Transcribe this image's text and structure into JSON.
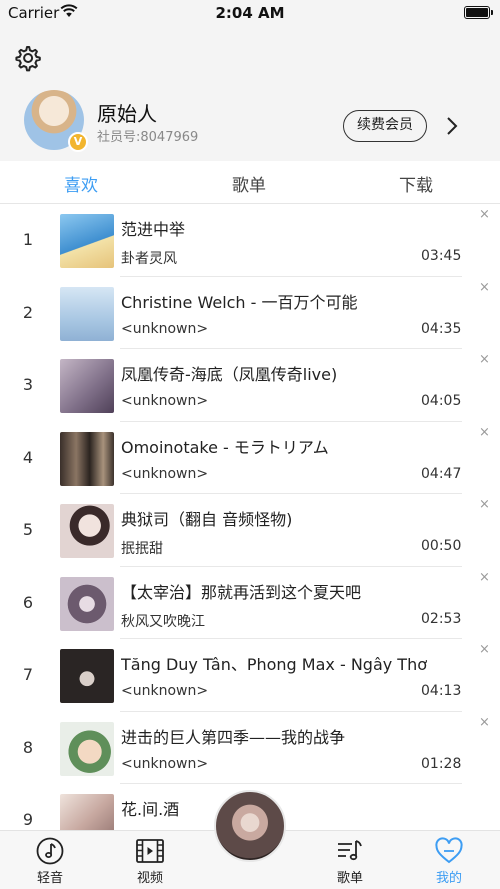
{
  "status_bar": {
    "carrier": "Carrier",
    "time": "2:04 AM"
  },
  "profile": {
    "name": "原始人",
    "member_id": "社员号:8047969",
    "badge": "V",
    "renew_label": "续费会员"
  },
  "tabs": [
    {
      "label": "喜欢",
      "active": true
    },
    {
      "label": "歌单",
      "active": false
    },
    {
      "label": "下载",
      "active": false
    }
  ],
  "songs": [
    {
      "num": "1",
      "title": "范进中举",
      "artist": "卦者灵风",
      "duration": "03:45",
      "thumb_color": "#5aa5dd"
    },
    {
      "num": "2",
      "title": "Christine Welch - 一百万个可能",
      "artist": "<unknown>",
      "duration": "04:35",
      "thumb_color": "#b9d2e8"
    },
    {
      "num": "3",
      "title": "凤凰传奇-海底（凤凰传奇live)",
      "artist": "<unknown>",
      "duration": "04:05",
      "thumb_color": "#9a8a9c"
    },
    {
      "num": "4",
      "title": "Omoinotake - モラトリアム",
      "artist": "<unknown>",
      "duration": "04:47",
      "thumb_color": "#6b5a4e"
    },
    {
      "num": "5",
      "title": "典狱司（翻自 音频怪物)",
      "artist": "抿抿甜",
      "duration": "00:50",
      "thumb_color": "#d8c6c4"
    },
    {
      "num": "6",
      "title": "【太宰治】那就再活到这个夏天吧",
      "artist": "秋风又吹晚江",
      "duration": "02:53",
      "thumb_color": "#a89aa8"
    },
    {
      "num": "7",
      "title": "Tăng Duy Tân、Phong Max - Ngây Thơ",
      "artist": "<unknown>",
      "duration": "04:13",
      "thumb_color": "#2f2b2a"
    },
    {
      "num": "8",
      "title": "进击的巨人第四季——我的战争",
      "artist": "<unknown>",
      "duration": "01:28",
      "thumb_color": "#7fbcae"
    },
    {
      "num": "9",
      "title": "花.间.酒",
      "artist": "",
      "duration": "",
      "thumb_color": "#d9c8c0"
    }
  ],
  "remove_glyph": "×",
  "tabbar": [
    {
      "label": "轻音",
      "icon": "music-note-icon",
      "active": false
    },
    {
      "label": "视频",
      "icon": "film-icon",
      "active": false
    },
    {
      "label": "歌单",
      "icon": "playlist-icon",
      "active": false
    },
    {
      "label": "我的",
      "icon": "heart-icon",
      "active": true
    }
  ],
  "colors": {
    "accent": "#3d9df3",
    "header_bg": "#f4f4f4",
    "badge": "#f2b52e"
  }
}
